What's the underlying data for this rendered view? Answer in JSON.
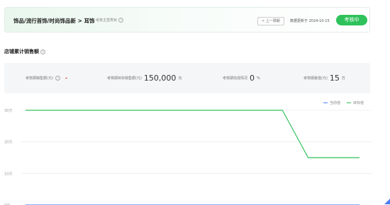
{
  "header": {
    "breadcrumb": "饰品/流行首饰/时尚饰品新 > 耳饰",
    "subtitle": "考核主营类目",
    "prev_button": "< 上一周期",
    "update_text": "数据更新于 2024-10-15",
    "status_button": "考核中"
  },
  "section_title": "店铺累计销售额",
  "stats": [
    {
      "label": "考核期销售额(元)",
      "value": "",
      "unit": ""
    },
    {
      "label": "考核期目标销售额(元)",
      "value": "150,000",
      "unit": "元"
    },
    {
      "label": "考核期完成情况",
      "value": "0",
      "unit": "%"
    },
    {
      "label": "考核期差值(元)",
      "value": "15",
      "unit": "万"
    }
  ],
  "colors": {
    "current": "#4e7df5",
    "target": "#2fc25b",
    "status_button": "#2fc25b",
    "accent_red": "#e8453c"
  },
  "chart_data": {
    "type": "line",
    "y_ticks": [
      "30万",
      "20万",
      "10万",
      "0万"
    ],
    "ylim": [
      0,
      30
    ],
    "x": [
      0,
      1,
      2,
      3,
      4,
      5,
      6,
      7,
      8,
      9,
      10,
      11,
      12,
      13
    ],
    "legend_position": "top-right",
    "grid": true,
    "series": [
      {
        "name": "当前值",
        "color": "#4e7df5",
        "values": [
          0,
          0,
          0,
          0,
          0,
          0,
          0,
          0,
          0,
          0,
          0,
          0,
          0,
          0
        ]
      },
      {
        "name": "目标值",
        "color": "#2fc25b",
        "values": [
          30,
          30,
          30,
          30,
          30,
          30,
          30,
          30,
          30,
          30,
          30,
          15,
          15,
          15
        ]
      }
    ]
  }
}
